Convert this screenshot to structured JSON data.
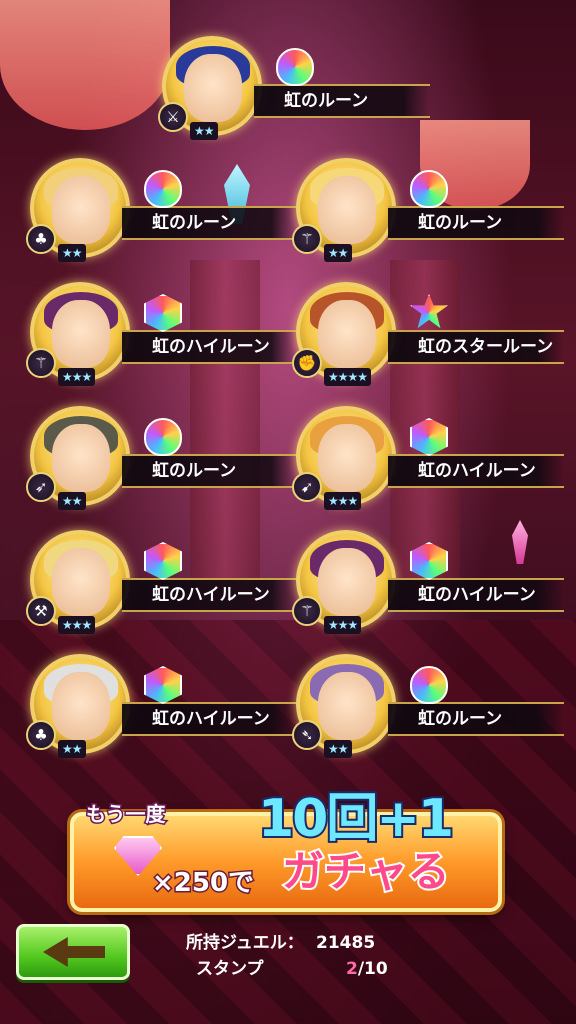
{
  "results": [
    {
      "name": "虹のルーン",
      "rune": "round",
      "type_icon": "sword-icon",
      "stars": "★★",
      "hue": "#2a3a9a"
    },
    {
      "name": "虹のルーン",
      "rune": "round",
      "type_icon": "leaf-icon",
      "stars": "★★",
      "hue": "#f2d07a"
    },
    {
      "name": "虹のルーン",
      "rune": "round",
      "type_icon": "staff-icon",
      "stars": "★★",
      "hue": "#f6d878"
    },
    {
      "name": "虹のハイルーン",
      "rune": "hex",
      "type_icon": "staff-icon",
      "stars": "★★★",
      "hue": "#6a2a6a"
    },
    {
      "name": "虹のスタールーン",
      "rune": "star",
      "type_icon": "fist-icon",
      "stars": "★★★★",
      "hue": "#b8542a"
    },
    {
      "name": "虹のルーン",
      "rune": "round",
      "type_icon": "arrow-icon",
      "stars": "★★",
      "hue": "#5a5a4a"
    },
    {
      "name": "虹のハイルーン",
      "rune": "hex",
      "type_icon": "bow-icon",
      "stars": "★★★",
      "hue": "#e8a040"
    },
    {
      "name": "虹のハイルーン",
      "rune": "hex",
      "type_icon": "axe-icon",
      "stars": "★★★",
      "hue": "#f0d880"
    },
    {
      "name": "虹のハイルーン",
      "rune": "hex",
      "type_icon": "staff-icon",
      "stars": "★★★",
      "hue": "#6a2a6a"
    },
    {
      "name": "虹のハイルーン",
      "rune": "hex",
      "type_icon": "leaf-icon",
      "stars": "★★",
      "hue": "#e0e0e0"
    },
    {
      "name": "虹のルーン",
      "rune": "round",
      "type_icon": "spear-icon",
      "stars": "★★",
      "hue": "#8a6ab0"
    }
  ],
  "gacha": {
    "again_label": "もう一度",
    "count_label": "10回+1",
    "cost_label": "×250で",
    "action_label": "ガチャる"
  },
  "status": {
    "jewel_label": "所持ジュエル：",
    "jewel_value": "21485",
    "stamp_label": "スタンプ",
    "stamp_current": "2",
    "stamp_total": "/10"
  }
}
